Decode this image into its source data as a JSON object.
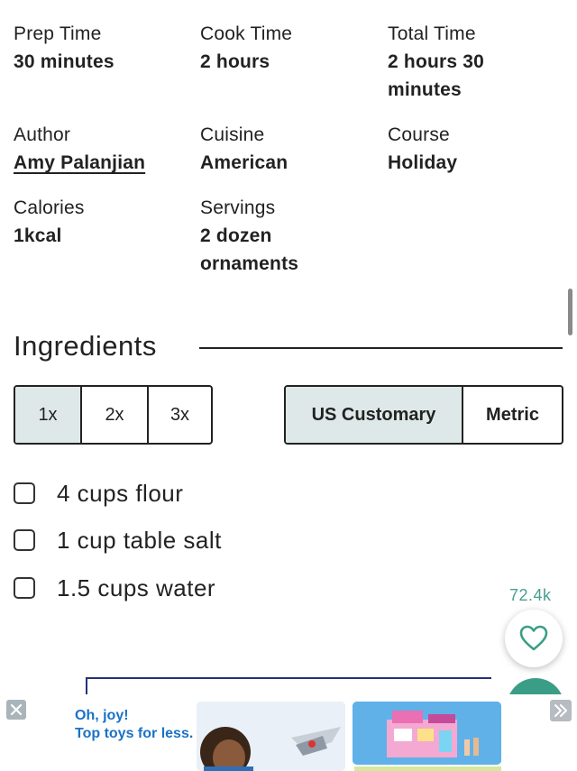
{
  "meta": {
    "prep_time": {
      "label": "Prep Time",
      "value": "30 minutes"
    },
    "cook_time": {
      "label": "Cook Time",
      "value": "2 hours"
    },
    "total_time": {
      "label": "Total Time",
      "value_line1": "2 hours 30",
      "value_line2": "minutes"
    },
    "author": {
      "label": "Author",
      "value": "Amy Palanjian"
    },
    "cuisine": {
      "label": "Cuisine",
      "value": "American"
    },
    "course": {
      "label": "Course",
      "value": "Holiday"
    },
    "calories": {
      "label": "Calories",
      "value": "1kcal"
    },
    "servings": {
      "label": "Servings",
      "value_line1": "2 dozen",
      "value_line2": "ornaments"
    }
  },
  "ingredients": {
    "title": "Ingredients",
    "scale_options": [
      "1x",
      "2x",
      "3x"
    ],
    "scale_selected": "1x",
    "unit_options": [
      "US Customary",
      "Metric"
    ],
    "unit_selected": "US Customary",
    "items": [
      "4 cups flour",
      "1 cup table salt",
      "1.5 cups water"
    ]
  },
  "favorite": {
    "count": "72.4k",
    "icon": "heart-icon"
  },
  "ad": {
    "headline_line1": "Oh, joy!",
    "headline_line2": "Top toys for less."
  },
  "colors": {
    "accent_teal": "#3a9e86",
    "favorite_count": "#4a9e91",
    "segment_active": "#dfe8e8",
    "ad_text": "#1a72c6"
  }
}
